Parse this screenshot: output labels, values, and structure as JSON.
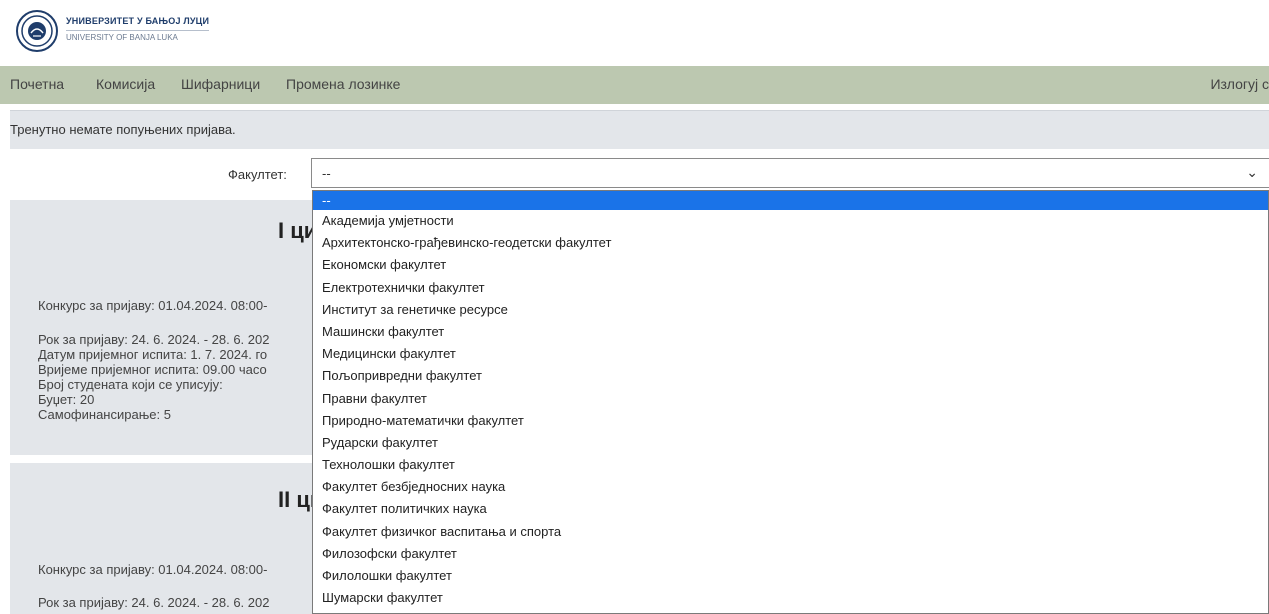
{
  "header": {
    "university_line1": "УНИВЕРЗИТЕТ У БАЊОЈ ЛУЦИ",
    "university_line2": "UNIVERSITY OF BANJA LUKA",
    "colors": {
      "logo_blue": "#1f3d6b"
    }
  },
  "nav": {
    "home": "Почетна",
    "commission": "Комисија",
    "codebooks": "Шифарници",
    "change_password": "Промена лозинке",
    "logout": "Излогуј с",
    "color": "#bcc8b0"
  },
  "notice": "Тренутно немате попуњених пријава.",
  "faculty_filter": {
    "label": "Факултет:",
    "selected": "--",
    "options": [
      "--",
      "Академија умјетности",
      "Архитектонско-грађевинско-геодетски факултет",
      "Економски факултет",
      "Електротехнички факултет",
      "Институт за генетичке ресурсе",
      "Машински факултет",
      "Медицински факултет",
      "Пољопривредни факултет",
      "Правни факултет",
      "Природно-математички факултет",
      "Рударски факултет",
      "Технолошки факултет",
      "Факултет безбједносних наука",
      "Факултет политичких наука",
      "Факултет физичког васпитања и спорта",
      "Филозофски факултет",
      "Филолошки факултет",
      "Шумарски факултет"
    ],
    "highlight_color": "#1a73e8"
  },
  "panels": [
    {
      "title": "I ци",
      "competition": "Конкурс за пријаву: 01.04.2024. 08:00-",
      "deadline": "Рок за пријаву: 24. 6. 2024. - 28. 6. 202",
      "exam_date": "Датум пријемног испита: 1. 7. 2024. го",
      "exam_time": "Вријеме пријемног испита: 09.00 часо",
      "students_count": "Број студената који се уписују:",
      "budget": "Буџет: 20",
      "self_financing": "Самофинансирање: 5"
    },
    {
      "title": "II ци",
      "competition": "Конкурс за пријаву: 01.04.2024. 08:00-",
      "deadline": "Рок за пријаву: 24. 6. 2024. - 28. 6. 202"
    }
  ]
}
